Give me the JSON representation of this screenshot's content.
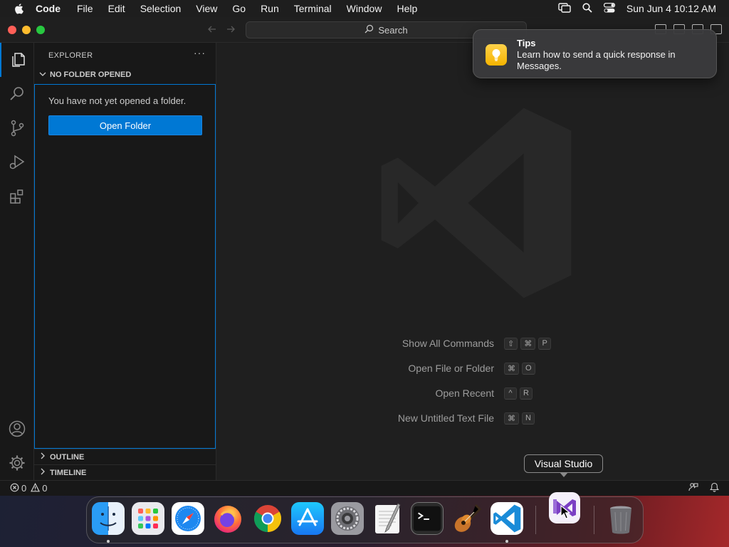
{
  "menubar": {
    "app_name": "Code",
    "items": [
      "File",
      "Edit",
      "Selection",
      "View",
      "Go",
      "Run",
      "Terminal",
      "Window",
      "Help"
    ],
    "datetime": "Sun Jun 4  10:12 AM"
  },
  "titlebar": {
    "search_label": "Search"
  },
  "sidebar": {
    "title": "EXPLORER",
    "section": "NO FOLDER OPENED",
    "message": "You have not yet opened a folder.",
    "open_folder_label": "Open Folder",
    "outline_label": "OUTLINE",
    "timeline_label": "TIMELINE"
  },
  "editor": {
    "shortcuts": [
      {
        "label": "Show All Commands",
        "keys": [
          "⇧",
          "⌘",
          "P"
        ]
      },
      {
        "label": "Open File or Folder",
        "keys": [
          "⌘",
          "O"
        ]
      },
      {
        "label": "Open Recent",
        "keys": [
          "^",
          "R"
        ]
      },
      {
        "label": "New Untitled Text File",
        "keys": [
          "⌘",
          "N"
        ]
      }
    ]
  },
  "statusbar": {
    "errors": "0",
    "warnings": "0"
  },
  "notification": {
    "title": "Tips",
    "body": "Learn how to send a quick response in Messages."
  },
  "tooltip": {
    "label": "Visual Studio"
  },
  "dock": {
    "apps": [
      "Finder",
      "Launchpad",
      "Safari",
      "Firefox",
      "Chrome",
      "App Store",
      "System Settings",
      "TextEdit",
      "Terminal",
      "GarageBand",
      "Visual Studio Code",
      "Visual Studio",
      "Trash"
    ]
  },
  "colors": {
    "accent": "#0078d4",
    "editor_bg": "#1f1f1f",
    "sidebar_bg": "#181818"
  }
}
